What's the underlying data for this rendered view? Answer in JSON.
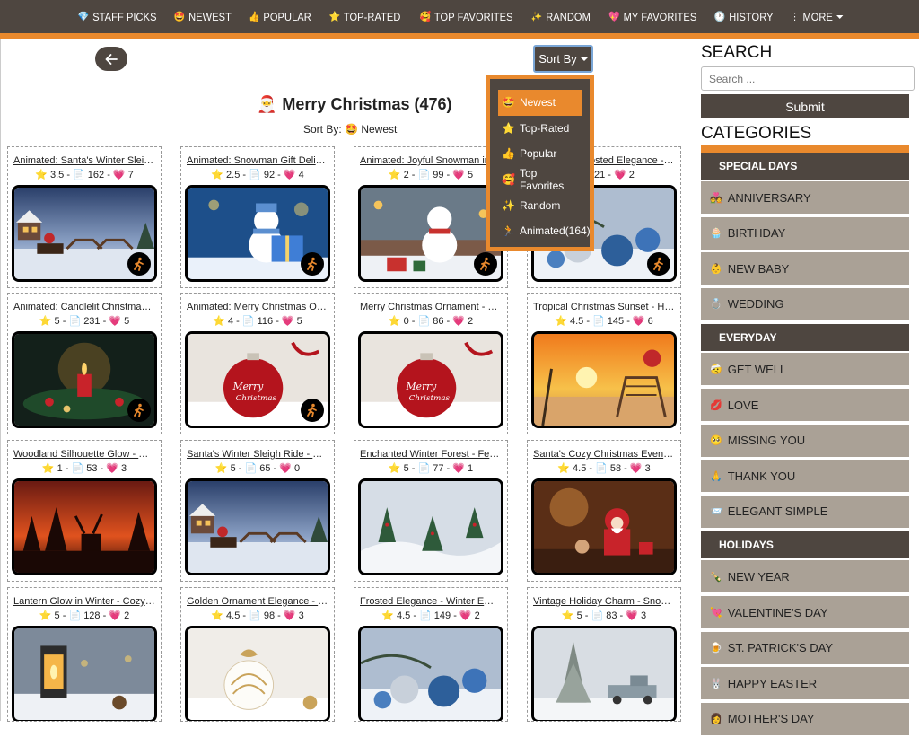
{
  "nav": [
    {
      "icon": "💎",
      "label": "STAFF PICKS"
    },
    {
      "icon": "🤩",
      "label": "NEWEST"
    },
    {
      "icon": "👍",
      "label": "POPULAR"
    },
    {
      "icon": "⭐",
      "label": "TOP-RATED"
    },
    {
      "icon": "🥰",
      "label": "TOP FAVORITES"
    },
    {
      "icon": "✨",
      "label": "RANDOM"
    },
    {
      "icon": "💖",
      "label": "MY FAVORITES"
    },
    {
      "icon": "🕐",
      "label": "HISTORY"
    },
    {
      "icon": "⋮",
      "label": "MORE"
    }
  ],
  "page": {
    "title_icon": "🎅",
    "title": "Merry Christmas (476)",
    "sort_prefix": "Sort By:",
    "sort_icon": "🤩",
    "sort_value": "Newest",
    "sort_button": "Sort By"
  },
  "sort_menu": [
    {
      "icon": "🤩",
      "label": "Newest"
    },
    {
      "icon": "⭐",
      "label": "Top-Rated"
    },
    {
      "icon": "👍",
      "label": "Popular"
    },
    {
      "icon": "🥰",
      "label": "Top Favorites"
    },
    {
      "icon": "✨",
      "label": "Random"
    },
    {
      "icon": "🏃",
      "label": "Animated(164)"
    }
  ],
  "cards": [
    {
      "title": "Animated: Santa's Winter Sleigh Ride - Holiday",
      "stats": "3.5 - 📄 162 - 💗 7",
      "animated": true,
      "scene": "sleigh"
    },
    {
      "title": "Animated: Snowman Gift Delight - Festive",
      "stats": "2.5 - 📄 92 - 💗 4",
      "animated": true,
      "scene": "snowman-gift"
    },
    {
      "title": "Animated: Joyful Snowman in Holiday",
      "stats": "2 - 📄 99 - 💗 5",
      "animated": true,
      "scene": "snowman-town"
    },
    {
      "title": "Animated: Frosted Elegance - Winter Email",
      "stats": "221 - 💗 2",
      "animated": true,
      "scene": "ornaments-blue"
    },
    {
      "title": "Animated: Candlelit Christmas Wreath - Holiday",
      "stats": "5 - 📄 231 - 💗 5",
      "animated": true,
      "scene": "candle"
    },
    {
      "title": "Animated: Merry Christmas Ornament - Festive",
      "stats": "4 - 📄 116 - 💗 5",
      "animated": true,
      "scene": "red-ornament"
    },
    {
      "title": "Merry Christmas Ornament - Festive Email",
      "stats": "0 - 📄 86 - 💗 2",
      "animated": false,
      "scene": "red-ornament"
    },
    {
      "title": "Tropical Christmas Sunset - Holiday Email",
      "stats": "4.5 - 📄 145 - 💗 6",
      "animated": false,
      "scene": "tropical"
    },
    {
      "title": "Woodland Silhouette Glow - Holiday Email",
      "stats": "1 - 📄 53 - 💗 3",
      "animated": false,
      "scene": "silhouette"
    },
    {
      "title": "Santa's Winter Sleigh Ride - Holiday Email",
      "stats": "5 - 📄 65 - 💗 0",
      "animated": false,
      "scene": "sleigh"
    },
    {
      "title": "Enchanted Winter Forest - Festive Email",
      "stats": "5 - 📄 77 - 💗 1",
      "animated": false,
      "scene": "forest"
    },
    {
      "title": "Santa's Cozy Christmas Evening - Festive",
      "stats": "4.5 - 📄 58 - 💗 3",
      "animated": false,
      "scene": "santa-cozy"
    },
    {
      "title": "Lantern Glow in Winter - Cozy Email Background",
      "stats": "5 - 📄 128 - 💗 2",
      "animated": false,
      "scene": "lantern"
    },
    {
      "title": "Golden Ornament Elegance - Holiday Email",
      "stats": "4.5 - 📄 98 - 💗 3",
      "animated": false,
      "scene": "gold-ornament"
    },
    {
      "title": "Frosted Elegance - Winter Email Background",
      "stats": "4.5 - 📄 149 - 💗 2",
      "animated": false,
      "scene": "ornaments-blue"
    },
    {
      "title": "Vintage Holiday Charm - Snowy Email",
      "stats": "5 - 📄 83 - 💗 3",
      "animated": false,
      "scene": "truck"
    }
  ],
  "sidebar": {
    "search_heading": "SEARCH",
    "search_placeholder": "Search ...",
    "submit": "Submit",
    "categories_heading": "CATEGORIES",
    "sections": [
      {
        "label": "SPECIAL DAYS",
        "items": [
          {
            "icon": "💑",
            "label": "ANNIVERSARY"
          },
          {
            "icon": "🧁",
            "label": "BIRTHDAY"
          },
          {
            "icon": "👶",
            "label": "NEW BABY"
          },
          {
            "icon": "💍",
            "label": "WEDDING"
          }
        ]
      },
      {
        "label": "EVERYDAY",
        "items": [
          {
            "icon": "🤕",
            "label": "GET WELL"
          },
          {
            "icon": "💋",
            "label": "LOVE"
          },
          {
            "icon": "🥺",
            "label": "MISSING YOU"
          },
          {
            "icon": "🙏",
            "label": "THANK YOU"
          },
          {
            "icon": "📨",
            "label": "ELEGANT SIMPLE"
          }
        ]
      },
      {
        "label": "HOLIDAYS",
        "items": [
          {
            "icon": "🍾",
            "label": "NEW YEAR"
          },
          {
            "icon": "💘",
            "label": "VALENTINE'S DAY"
          },
          {
            "icon": "🍺",
            "label": "ST. PATRICK'S DAY"
          },
          {
            "icon": "🐰",
            "label": "HAPPY EASTER"
          },
          {
            "icon": "👩",
            "label": "MOTHER'S DAY"
          }
        ]
      }
    ]
  }
}
